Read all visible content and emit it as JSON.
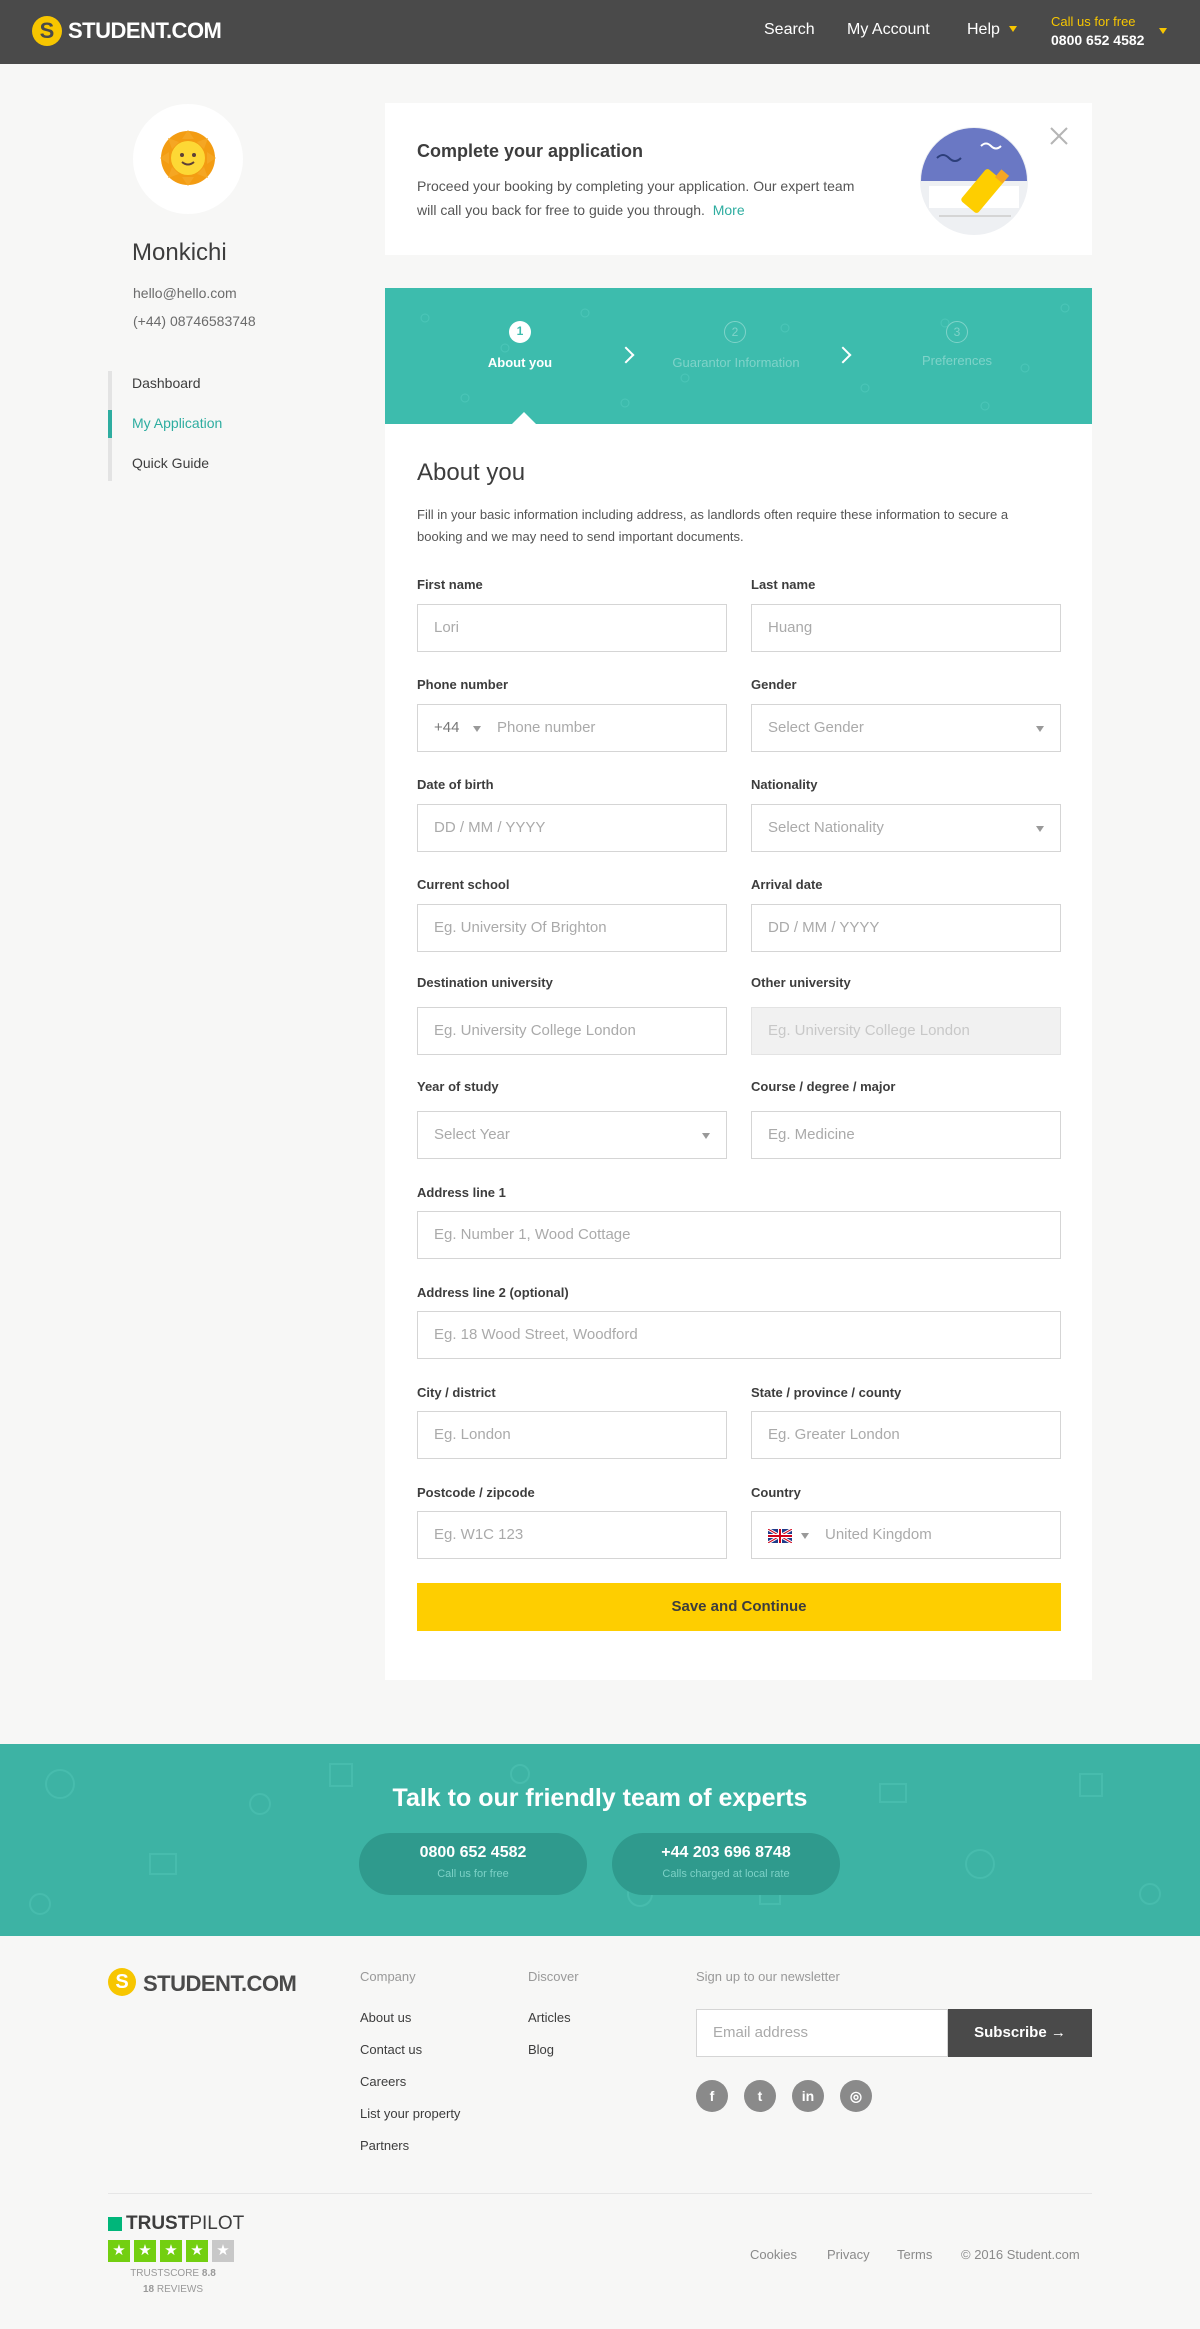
{
  "header": {
    "logo": "STUDENT.COM",
    "nav": [
      "Search",
      "My Account",
      "Help"
    ],
    "call_free": "Call us for free",
    "call_number": "0800 652 4582"
  },
  "sidebar": {
    "name": "Monkichi",
    "email": "hello@hello.com",
    "phone": "(+44) 08746583748",
    "items": [
      {
        "label": "Dashboard",
        "active": false
      },
      {
        "label": "My Application",
        "active": true
      },
      {
        "label": "Quick Guide",
        "active": false
      }
    ]
  },
  "complete": {
    "title": "Complete your application",
    "text": "Proceed your booking by completing your application. Our expert team will call you back for free to guide you through.",
    "more": "More"
  },
  "steps": [
    {
      "num": "1",
      "label": "About you"
    },
    {
      "num": "2",
      "label": "Guarantor Information"
    },
    {
      "num": "3",
      "label": "Preferences"
    }
  ],
  "form": {
    "title": "About you",
    "intro": "Fill in your basic information including address, as landlords often require these information to secure a booking and we may need to send important documents.",
    "first_name": {
      "label": "First name",
      "placeholder": "Lori"
    },
    "last_name": {
      "label": "Last name",
      "placeholder": "Huang"
    },
    "phone": {
      "label": "Phone number",
      "code": "+44",
      "placeholder": "Phone number"
    },
    "gender": {
      "label": "Gender",
      "value": "Select Gender"
    },
    "dob": {
      "label": "Date of birth",
      "placeholder": "DD / MM / YYYY"
    },
    "nationality": {
      "label": "Nationality",
      "value": "Select Nationality"
    },
    "current_school": {
      "label": "Current school",
      "placeholder": "Eg. University Of Brighton"
    },
    "arrival_date": {
      "label": "Arrival date",
      "placeholder": "DD / MM / YYYY"
    },
    "destination_university": {
      "label": "Destination university",
      "placeholder": "Eg. University College London"
    },
    "other_university": {
      "label": "Other university",
      "placeholder": "Eg. University College London"
    },
    "year_of_study": {
      "label": "Year of study",
      "value": "Select Year"
    },
    "course": {
      "label": "Course / degree / major",
      "placeholder": "Eg. Medicine"
    },
    "address1": {
      "label": "Address line 1",
      "placeholder": "Eg. Number 1, Wood Cottage"
    },
    "address2": {
      "label": "Address line 2 (optional)",
      "placeholder": "Eg. 18 Wood Street, Woodford"
    },
    "city": {
      "label": "City / district",
      "placeholder": "Eg. London"
    },
    "state": {
      "label": "State / province / county",
      "placeholder": "Eg. Greater London"
    },
    "postcode": {
      "label": "Postcode / zipcode",
      "placeholder": "Eg. W1C 123"
    },
    "country": {
      "label": "Country",
      "value": "United Kingdom"
    },
    "submit": "Save and Continue"
  },
  "contact": {
    "title": "Talk to our friendly team of experts",
    "phones": [
      {
        "number": "0800 652 4582",
        "note": "Call us for free"
      },
      {
        "number": "+44 203 696 8748",
        "note": "Calls charged at local rate"
      }
    ]
  },
  "footer": {
    "logo": "STUDENT.COM",
    "company_heading": "Company",
    "company_links": [
      "About us",
      "Contact us",
      "Careers",
      "List your property",
      "Partners"
    ],
    "discover_heading": "Discover",
    "discover_links": [
      "Articles",
      "Blog"
    ],
    "newsletter_heading": "Sign up to our newsletter",
    "newsletter_placeholder": "Email address",
    "subscribe": "Subscribe →",
    "social_icons": [
      "facebook-icon",
      "twitter-icon",
      "linkedin-icon",
      "instagram-icon"
    ],
    "trustpilot": {
      "brand_a": "TRUST",
      "brand_b": "PILOT",
      "score_label": "TRUSTSCORE",
      "score": "8.8",
      "reviews_count": "18",
      "reviews_label": "REVIEWS",
      "stars": 4,
      "max_stars": 5
    },
    "bottom_links": [
      "Cookies",
      "Privacy",
      "Terms"
    ],
    "copyright": "© 2016 Student.com"
  },
  "colors": {
    "brand_yellow": "#fece00",
    "teal": "#3dbcad",
    "dark": "#4a4a4a"
  }
}
